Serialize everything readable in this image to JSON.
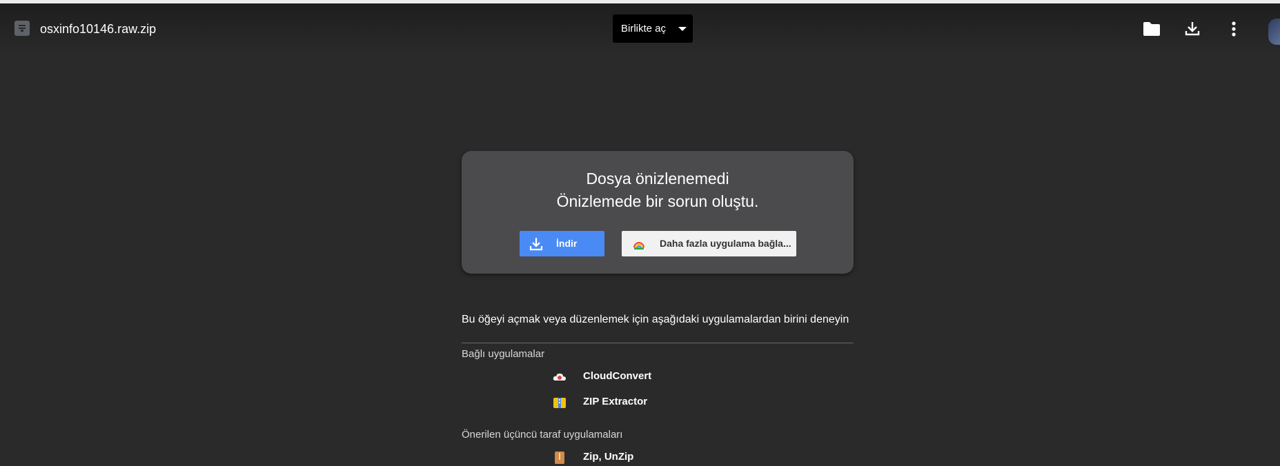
{
  "header": {
    "file_name": "osxinfo10146.raw.zip",
    "open_with_label": "Birlikte aç",
    "icons": [
      "file-type-icon",
      "folder-icon",
      "download-icon",
      "more-vert-icon",
      "avatar"
    ]
  },
  "preview_card": {
    "title": "Dosya önizlenemedi",
    "subtitle": "Önizlemede bir sorun oluştu.",
    "download_label": "İndir",
    "more_apps_label": "Daha fazla uygulama bağla..."
  },
  "apps_section": {
    "hint": "Bu öğeyi açmak veya düzenlemek için aşağıdaki uygulamalardan birini deneyin",
    "connected_title": "Bağlı uygulamalar",
    "connected_apps": [
      {
        "name": "CloudConvert",
        "icon": "cloudconvert-icon"
      },
      {
        "name": "ZIP Extractor",
        "icon": "zip-extractor-icon"
      }
    ],
    "suggested_title": "Önerilen üçüncü taraf uygulamaları",
    "suggested_apps": [
      {
        "name": "Zip, UnZip",
        "icon": "zip-unzip-icon"
      }
    ]
  },
  "colors": {
    "background": "#2a2a2a",
    "card": "#4b4b4d",
    "download_button": "#4a8af4",
    "more_button": "#f1f1f1"
  }
}
